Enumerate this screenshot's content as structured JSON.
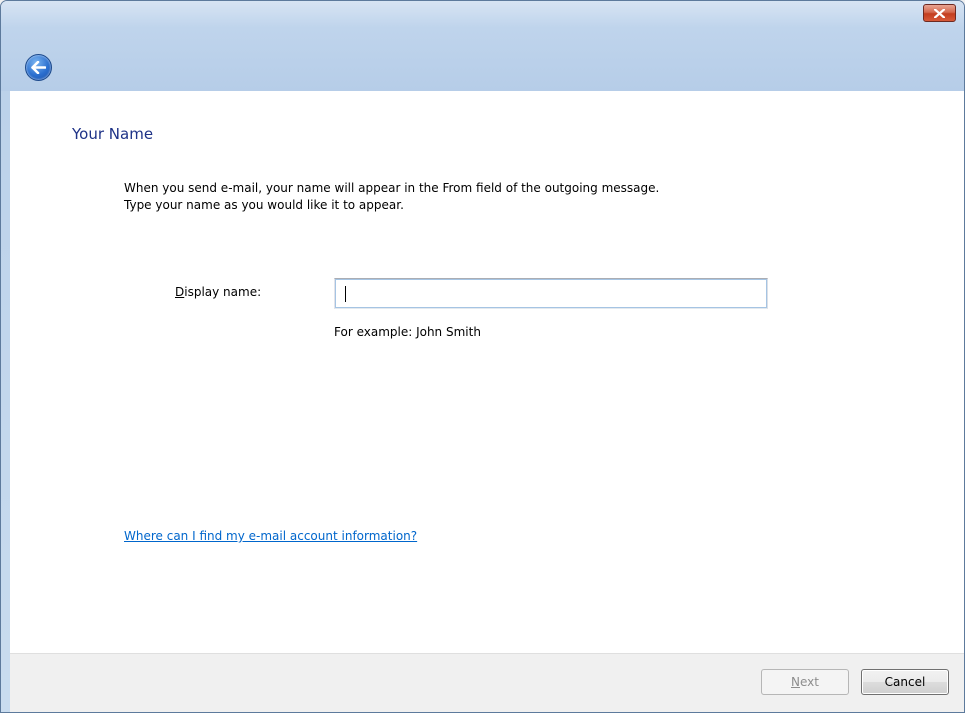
{
  "window": {
    "close_icon": "close-icon",
    "back_icon": "back-arrow-icon"
  },
  "page": {
    "title": "Your Name",
    "instruction_line1": "When you send e-mail, your name will appear in the From field of the outgoing message.",
    "instruction_line2": "Type your name as you would like it to appear."
  },
  "form": {
    "display_name_label_accel": "D",
    "display_name_label_rest": "isplay name:",
    "display_name_value": "",
    "example_text": "For example: John Smith"
  },
  "help": {
    "link_text": "Where can I find my e-mail account information?"
  },
  "footer": {
    "next_label_accel": "N",
    "next_label_rest": "ext",
    "next_enabled": false,
    "cancel_label": "Cancel"
  },
  "colors": {
    "title_blue": "#1e3287",
    "link_blue": "#0066cc",
    "close_red": "#c33e1f"
  }
}
